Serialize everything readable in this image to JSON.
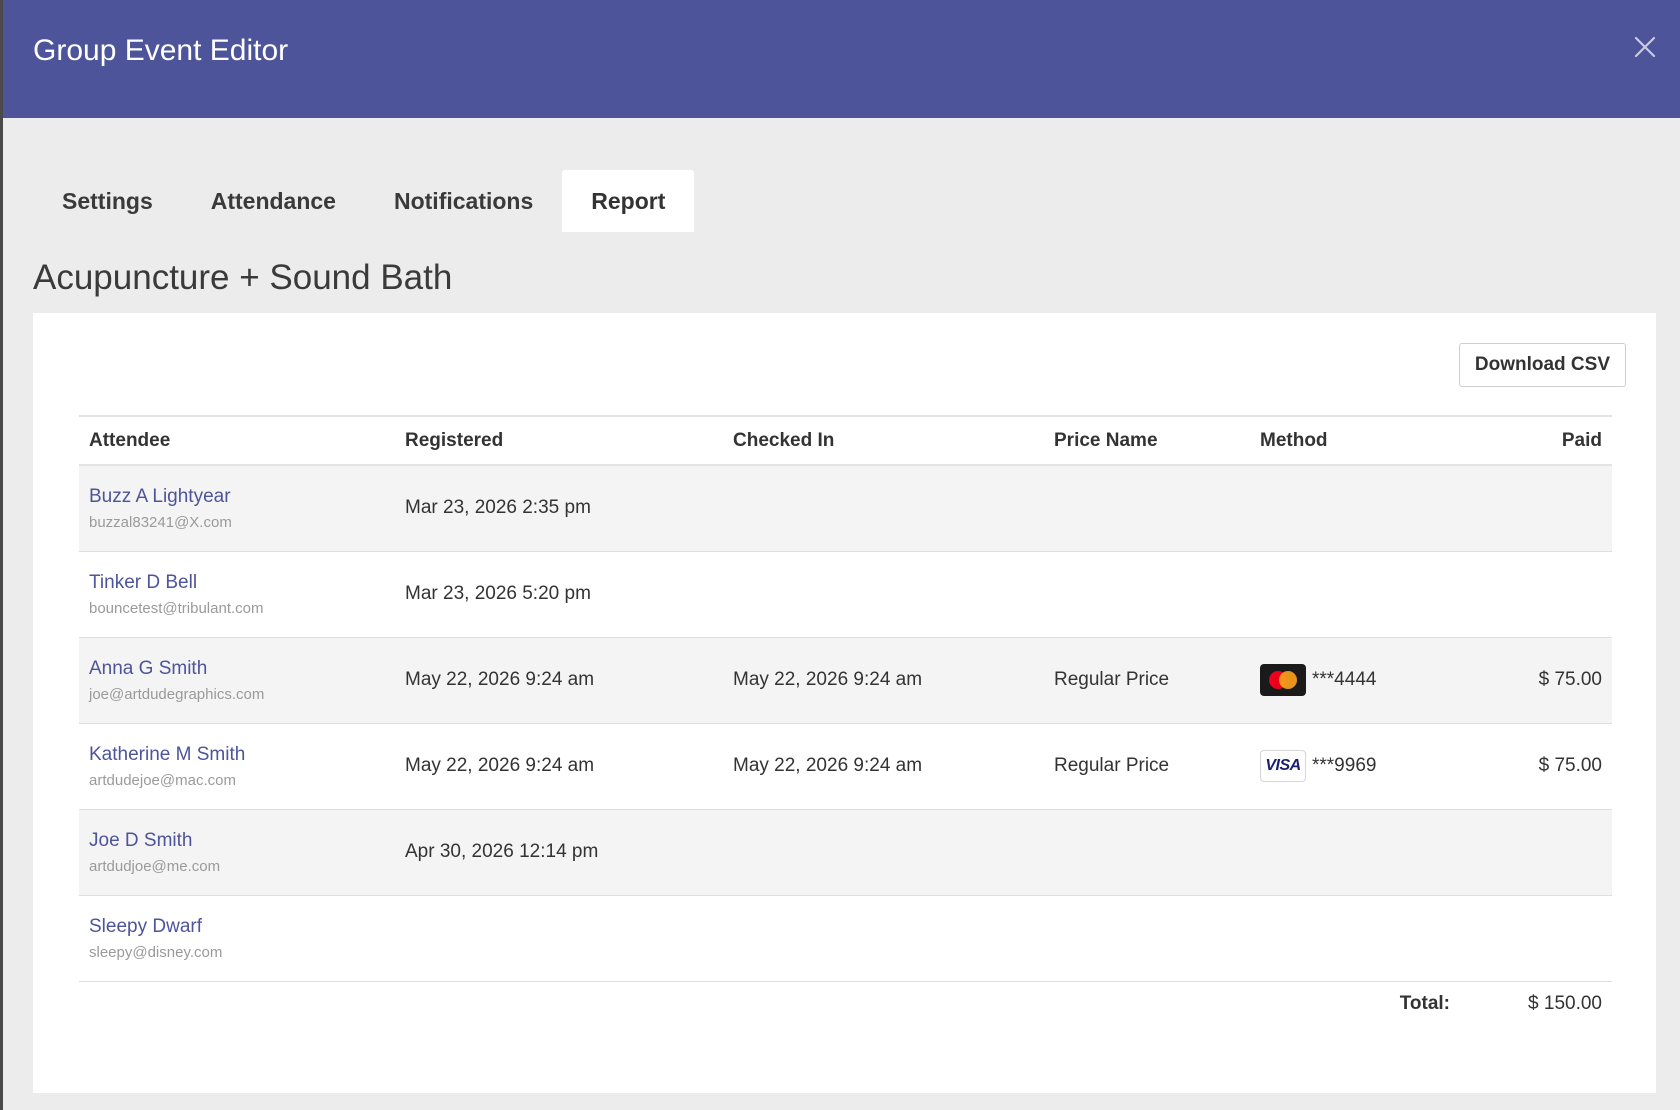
{
  "window": {
    "title": "Group Event Editor",
    "close_icon": "close-icon"
  },
  "tabs": [
    {
      "label": "Settings",
      "active": false
    },
    {
      "label": "Attendance",
      "active": false
    },
    {
      "label": "Notifications",
      "active": false
    },
    {
      "label": "Report",
      "active": true
    }
  ],
  "event": {
    "title": "Acupuncture + Sound Bath"
  },
  "toolbar": {
    "download_csv_label": "Download CSV"
  },
  "table": {
    "headers": {
      "attendee": "Attendee",
      "registered": "Registered",
      "checked_in": "Checked In",
      "price_name": "Price Name",
      "method": "Method",
      "paid": "Paid"
    },
    "rows": [
      {
        "name": "Buzz A Lightyear",
        "email": "buzzal83241@X.com",
        "registered": "Mar 23, 2026 2:35 pm",
        "checked_in": "",
        "price_name": "",
        "method_card": "",
        "method_last4": "",
        "paid": ""
      },
      {
        "name": "Tinker D Bell",
        "email": "bouncetest@tribulant.com",
        "registered": "Mar 23, 2026 5:20 pm",
        "checked_in": "",
        "price_name": "",
        "method_card": "",
        "method_last4": "",
        "paid": ""
      },
      {
        "name": "Anna G Smith",
        "email": "joe@artdudegraphics.com",
        "registered": "May 22, 2026 9:24 am",
        "checked_in": "May 22, 2026 9:24 am",
        "price_name": "Regular Price",
        "method_card": "mastercard",
        "method_last4": "***4444",
        "paid": "$ 75.00"
      },
      {
        "name": "Katherine M Smith",
        "email": "artdudejoe@mac.com",
        "registered": "May 22, 2026 9:24 am",
        "checked_in": "May 22, 2026 9:24 am",
        "price_name": "Regular Price",
        "method_card": "visa",
        "method_last4": "***9969",
        "paid": "$ 75.00"
      },
      {
        "name": "Joe D Smith",
        "email": "artdudjoe@me.com",
        "registered": "Apr 30, 2026 12:14 pm",
        "checked_in": "",
        "price_name": "",
        "method_card": "",
        "method_last4": "",
        "paid": ""
      },
      {
        "name": "Sleepy Dwarf",
        "email": "sleepy@disney.com",
        "registered": "",
        "checked_in": "",
        "price_name": "",
        "method_card": "",
        "method_last4": "",
        "paid": ""
      }
    ],
    "card_brand_text": {
      "visa": "VISA"
    },
    "total": {
      "label": "Total:",
      "value": "$ 150.00"
    }
  },
  "colors": {
    "header_bg": "#4d5499",
    "link": "#4d5499",
    "mastercard_red": "#eb001b",
    "mastercard_orange": "#f79e1b",
    "visa_blue": "#1a1f71"
  }
}
